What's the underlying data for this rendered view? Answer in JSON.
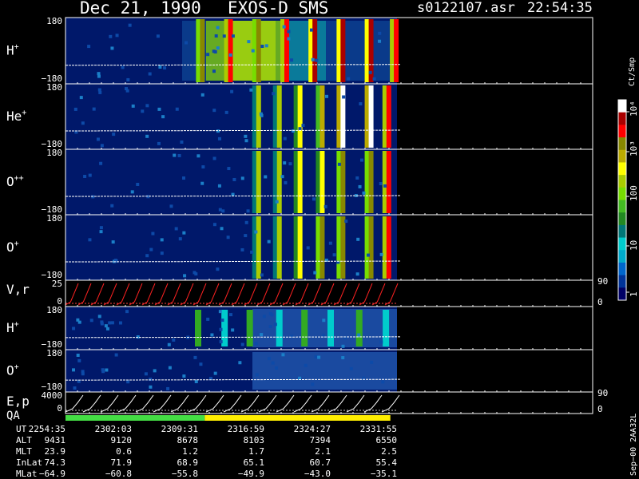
{
  "header": {
    "date": "Dec 21, 1990",
    "instrument": "EXOS-D SMS",
    "file": "s0122107.asr",
    "time": "22:54:35"
  },
  "colorbar": {
    "label": "Ct/Smp",
    "ticks": [
      "10⁴",
      "10³",
      "100",
      "10",
      "1"
    ],
    "stops": [
      "#000066",
      "#003399",
      "#0066cc",
      "#00aacc",
      "#00cccc",
      "#007777",
      "#228822",
      "#44bb22",
      "#77dd00",
      "#aacc00",
      "#ffff00",
      "#bbaa00",
      "#888800",
      "#ff0000",
      "#aa0000",
      "#ffffff"
    ]
  },
  "panels": [
    {
      "id": "h-plus",
      "label": "H",
      "sup": "+",
      "ytop": "180",
      "ybot": "−180"
    },
    {
      "id": "he-plus",
      "label": "He",
      "sup": "+",
      "ytop": "180",
      "ybot": "−180"
    },
    {
      "id": "o-pp",
      "label": "O",
      "sup": "++",
      "ytop": "180",
      "ybot": "−180"
    },
    {
      "id": "o-plus",
      "label": "O",
      "sup": "+",
      "ytop": "180",
      "ybot": "−180"
    },
    {
      "id": "vr",
      "label": "V,r",
      "sup": "",
      "ytop": "25",
      "ybot": "0",
      "rtop": "90",
      "rbot": "0"
    },
    {
      "id": "h-plus-2",
      "label": "H",
      "sup": "+",
      "ytop": "180",
      "ybot": "−180"
    },
    {
      "id": "o-plus-2",
      "label": "O",
      "sup": "+",
      "ytop": "180",
      "ybot": "−180"
    },
    {
      "id": "ep",
      "label": "E,p",
      "sup": "",
      "ytop": "4000",
      "ybot": "0",
      "rtop": "90",
      "rbot": "0"
    }
  ],
  "qa": {
    "label": "QA",
    "segments": [
      {
        "color": "#44dd44",
        "fraction": 0.42
      },
      {
        "color": "#ffee00",
        "fraction": 0.56
      }
    ]
  },
  "ephemeris": {
    "labels": [
      "UT",
      "ALT",
      "MLT",
      "InLat",
      "MLat"
    ],
    "columns": [
      {
        "UT": "2254:35",
        "ALT": "9431",
        "MLT": "23.9",
        "InLat": "74.3",
        "MLat": "−64.9"
      },
      {
        "UT": "2302:03",
        "ALT": "9120",
        "MLT": "0.6",
        "InLat": "71.9",
        "MLat": "−60.8"
      },
      {
        "UT": "2309:31",
        "ALT": "8678",
        "MLT": "1.2",
        "InLat": "68.9",
        "MLat": "−55.8"
      },
      {
        "UT": "2316:59",
        "ALT": "8103",
        "MLT": "1.7",
        "InLat": "65.1",
        "MLat": "−49.9"
      },
      {
        "UT": "2324:27",
        "ALT": "7394",
        "MLT": "2.1",
        "InLat": "60.7",
        "MLat": "−43.0"
      },
      {
        "UT": "2331:55",
        "ALT": "6550",
        "MLT": "2.5",
        "InLat": "55.4",
        "MLat": "−35.1"
      }
    ]
  },
  "footer": "Sep−00 2AA32L",
  "chart_data": {
    "type": "heatmap",
    "x_ticks": [
      "2254:35",
      "2302:03",
      "2309:31",
      "2316:59",
      "2324:27",
      "2331:55"
    ],
    "bands": [
      {
        "name": "H+",
        "x": [
          "2310:00",
          "2313:10",
          "2316:20",
          "2319:30",
          "2322:40",
          "2325:50",
          "2329:00",
          "2331:50"
        ],
        "level": [
          12,
          13,
          12,
          13,
          14,
          14,
          14,
          13
        ]
      },
      {
        "name": "He+",
        "x": [
          "2316:20",
          "2318:40",
          "2321:00",
          "2323:30",
          "2325:50",
          "2329:00",
          "2331:00"
        ],
        "level": [
          9,
          9,
          10,
          11,
          15,
          15,
          13
        ]
      },
      {
        "name": "O++",
        "x": [
          "2316:20",
          "2318:40",
          "2321:00",
          "2323:30",
          "2325:50",
          "2329:00",
          "2331:00"
        ],
        "level": [
          9,
          9,
          10,
          10,
          12,
          12,
          13
        ]
      },
      {
        "name": "O+",
        "x": [
          "2316:20",
          "2318:40",
          "2321:00",
          "2323:30",
          "2325:50",
          "2329:00",
          "2331:00"
        ],
        "level": [
          9,
          9,
          10,
          12,
          12,
          12,
          13
        ]
      }
    ]
  }
}
